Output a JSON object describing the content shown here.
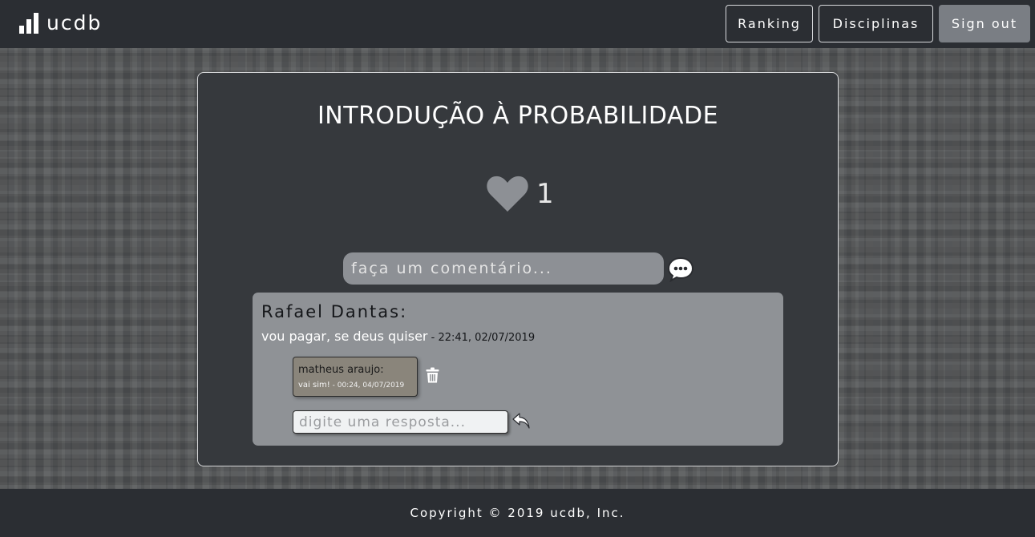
{
  "nav": {
    "brand": "ucdb",
    "ranking_label": "Ranking",
    "disciplines_label": "Disciplinas",
    "signout_label": "Sign out"
  },
  "course": {
    "title": "INTRODUÇÃO À PROBABILIDADE",
    "likes": "1"
  },
  "comment_form": {
    "placeholder": "faça um comentário..."
  },
  "comments": [
    {
      "author": "Rafael Dantas:",
      "text": "vou pagar, se deus quiser",
      "timestamp": " - 22:41, 02/07/2019",
      "replies": [
        {
          "author": "matheus araujo:",
          "text": "vai sim!",
          "timestamp": " - 00:24, 04/07/2019"
        }
      ],
      "reply_placeholder": "digite uma resposta..."
    }
  ],
  "footer": {
    "copyright": "Copyright © 2019 ucdb, Inc."
  },
  "colors": {
    "navbar": "#2b2e33",
    "card": "#36393d",
    "comment_box": "#8f9296",
    "reply_box": "#8a857b",
    "heart": "#8d9095"
  },
  "icons": [
    "bar-chart-icon",
    "heart-icon",
    "speech-bubble-icon",
    "trash-icon",
    "reply-arrow-icon"
  ]
}
